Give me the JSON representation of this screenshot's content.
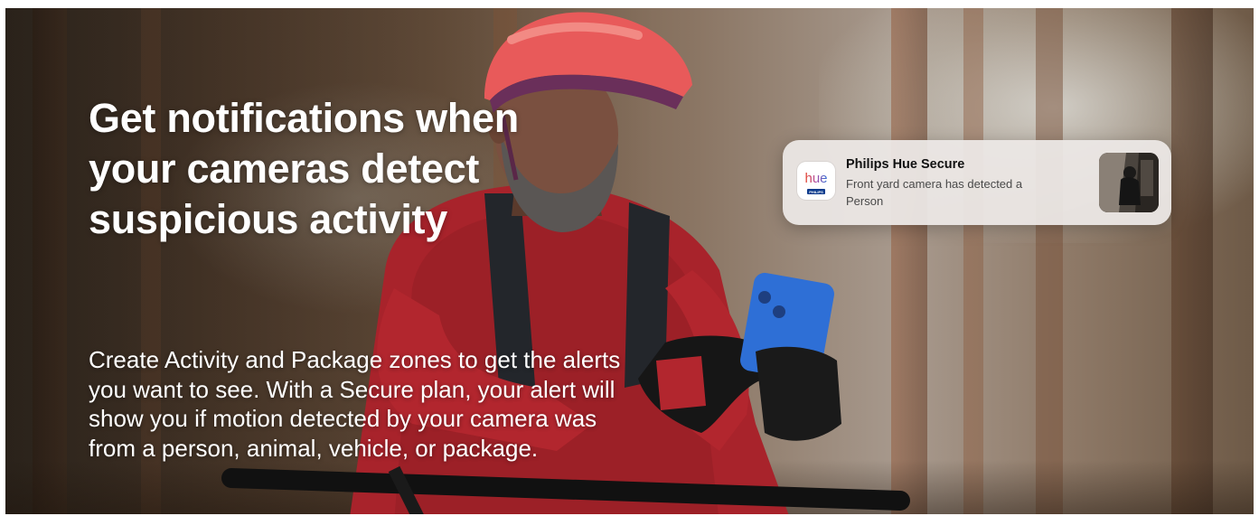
{
  "hero": {
    "headline": "Get notifications when your cameras detect suspicious activity",
    "body": "Create Activity and Package zones to get the alerts you want to see. With a Secure plan, your alert will show you if motion detected by your camera was from a person, animal, vehicle, or package."
  },
  "notification": {
    "app_icon": "hue-app-icon",
    "app_icon_text": "hue",
    "app_icon_subtext": "PHILIPS",
    "title": "Philips Hue Secure",
    "message": "Front yard camera has detected a Person",
    "thumbnail": "camera-snapshot-thumbnail"
  },
  "colors": {
    "helmet": "#e85a5a",
    "jacket": "#b0242a",
    "phone": "#2e6fd6",
    "hue_gradient_start": "#e8452a",
    "hue_gradient_end": "#2a6fd6"
  }
}
